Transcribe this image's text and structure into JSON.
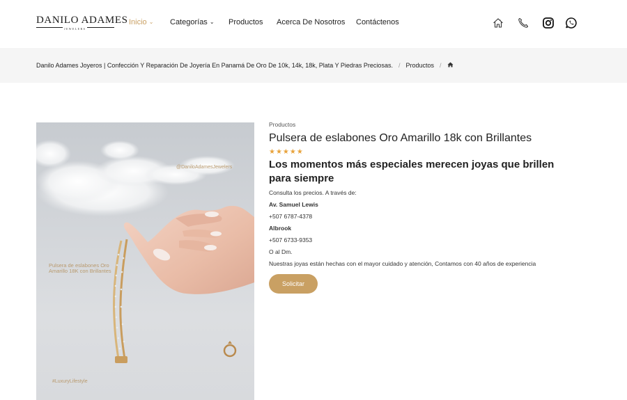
{
  "brand": {
    "name": "DANILO ADAMES",
    "tagline": "JEWELERS"
  },
  "nav": {
    "items": [
      {
        "label": "Inicio",
        "chevron": "⌄"
      },
      {
        "label": "Categorías",
        "chevron": "⌄"
      },
      {
        "label": "Productos",
        "chevron": ""
      },
      {
        "label": "Acerca De Nosotros",
        "chevron": ""
      },
      {
        "label": "Contáctenos",
        "chevron": ""
      }
    ],
    "icons": [
      "home-icon",
      "phone-icon",
      "instagram-icon",
      "whatsapp-icon"
    ]
  },
  "breadcrumb": {
    "home_title": "Danilo Adames Joyeros | Confección Y Reparación De Joyería En Panamá De Oro De 10k, 14k, 18k, Plata Y Piedras Preciosas.",
    "separator": "/",
    "section": "Productos",
    "icon": "home-icon"
  },
  "image": {
    "handle": "@DaniloAdamesJewelers",
    "caption": "Pulsera de eslabones Oro Amarillo 18K con Brillantes",
    "hashtag": "#LuxuryLifestyle"
  },
  "product": {
    "category": "Productos",
    "title": "Pulsera de eslabones Oro Amarillo 18k con Brillantes",
    "rating": "★★★★★",
    "headline": "Los momentos más especiales merecen joyas que brillen para siempre",
    "lines": [
      {
        "text": "Consulta los precios. A través de:",
        "bold": false
      },
      {
        "text": "Av. Samuel Lewis",
        "bold": true
      },
      {
        "text": "+507 6787-4378",
        "bold": false
      },
      {
        "text": "Albrook",
        "bold": true
      },
      {
        "text": "+507 6733-9353",
        "bold": false
      },
      {
        "text": "O al Dm.",
        "bold": false
      },
      {
        "text": "Nuestras joyas están hechas con el mayor cuidado y atención, Contamos con 40 años de experiencia",
        "bold": false
      }
    ],
    "cta_label": "Solicitar"
  },
  "colors": {
    "accent": "#c9a063",
    "band": "#f5f5f5",
    "stars": "#e8a33c",
    "text": "#222222"
  }
}
